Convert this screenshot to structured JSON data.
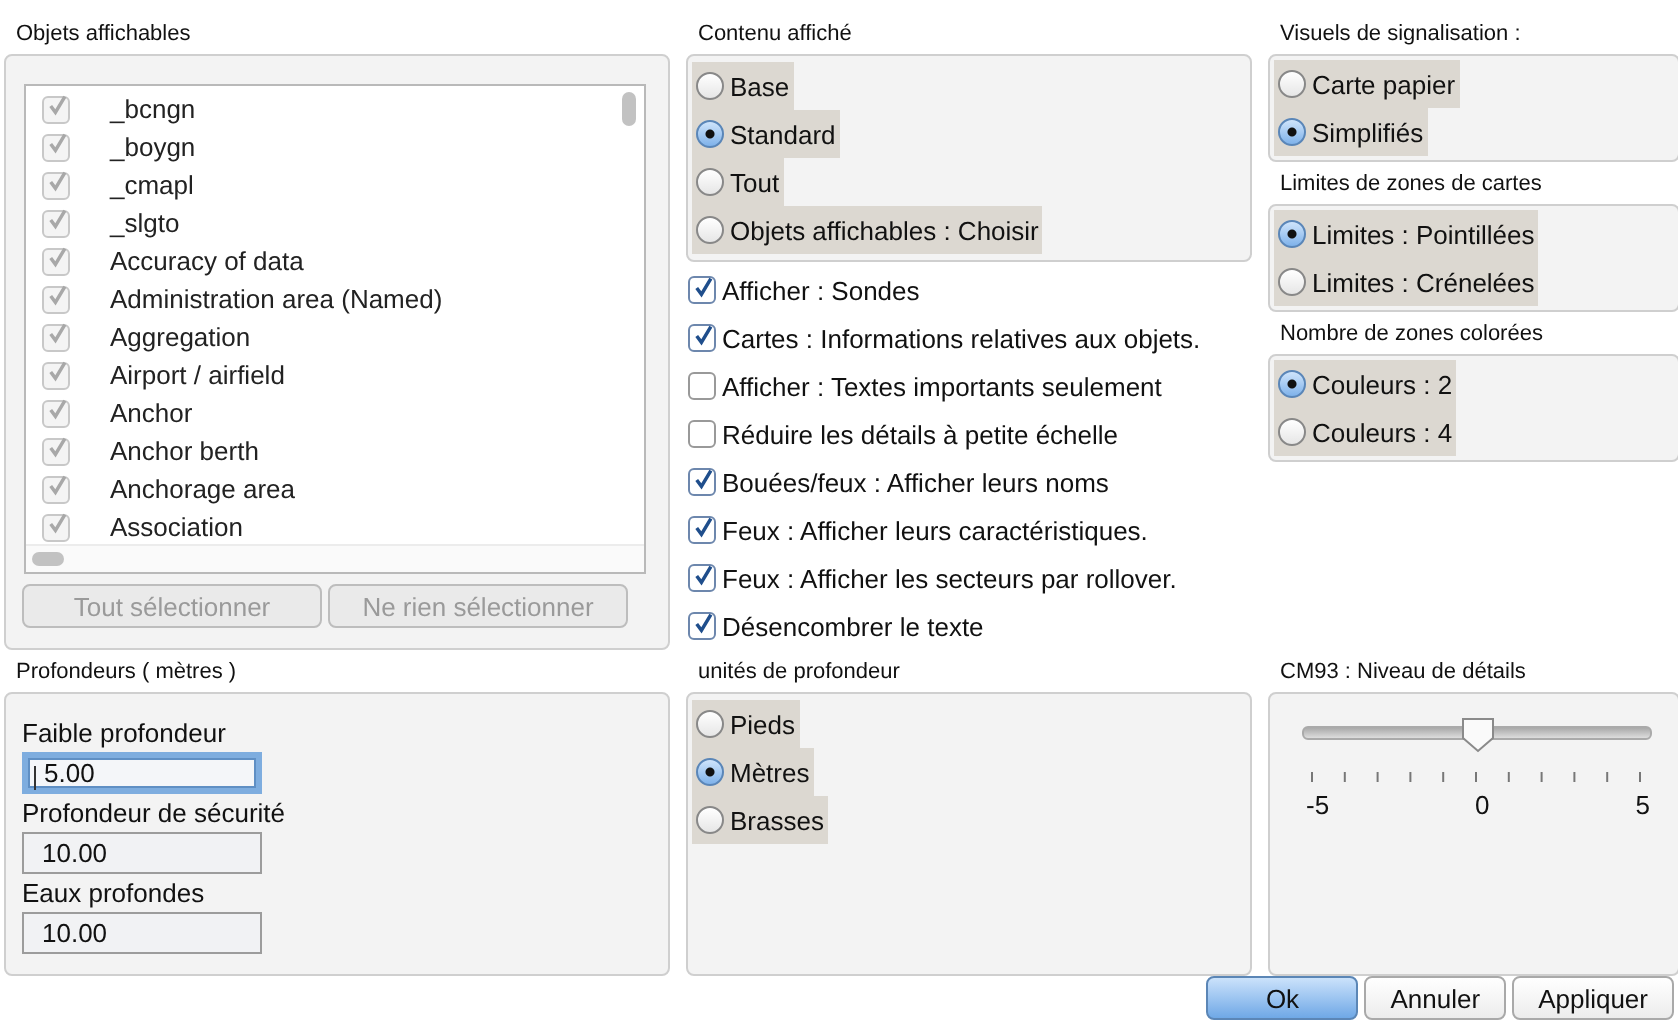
{
  "objets_affichables": {
    "title": "Objets affichables",
    "disabled": true,
    "items": [
      {
        "label": "_bcngn",
        "checked": true
      },
      {
        "label": "_boygn",
        "checked": true
      },
      {
        "label": "_cmapl",
        "checked": true
      },
      {
        "label": "_slgto",
        "checked": true
      },
      {
        "label": "Accuracy of data",
        "checked": true
      },
      {
        "label": "Administration area (Named)",
        "checked": true
      },
      {
        "label": "Aggregation",
        "checked": true
      },
      {
        "label": "Airport / airfield",
        "checked": true
      },
      {
        "label": "Anchor",
        "checked": true
      },
      {
        "label": "Anchor berth",
        "checked": true
      },
      {
        "label": "Anchorage area",
        "checked": true
      },
      {
        "label": "Association",
        "checked": true
      }
    ],
    "buttons": [
      {
        "label": "Tout sélectionner",
        "disabled": true
      },
      {
        "label": "Ne rien sélectionner",
        "disabled": true
      }
    ]
  },
  "contenu_affiche": {
    "title": "Contenu affiché",
    "options": [
      {
        "label": "Base",
        "selected": false
      },
      {
        "label": "Standard",
        "selected": true
      },
      {
        "label": "Tout",
        "selected": false
      },
      {
        "label": "Objets affichables : Choisir",
        "selected": false
      }
    ]
  },
  "options": [
    {
      "label": "Afficher : Sondes",
      "checked": true
    },
    {
      "label": "Cartes : Informations relatives aux objets.",
      "checked": true
    },
    {
      "label": "Afficher : Textes importants seulement",
      "checked": false
    },
    {
      "label": "Réduire les détails à petite échelle",
      "checked": false
    },
    {
      "label": "Bouées/feux : Afficher leurs noms",
      "checked": true
    },
    {
      "label": "Feux : Afficher leurs caractéristiques.",
      "checked": true
    },
    {
      "label": "Feux : Afficher les secteurs par rollover.",
      "checked": true
    },
    {
      "label": "Désencombrer le texte",
      "checked": true
    }
  ],
  "visuels_de_signalisation": {
    "title": "Visuels de signalisation :",
    "options": [
      {
        "label": "Carte papier",
        "selected": false
      },
      {
        "label": "Simplifiés",
        "selected": true
      }
    ]
  },
  "limites_de_zones": {
    "title": "Limites de zones de cartes",
    "options": [
      {
        "label": "Limites : Pointillées",
        "selected": true
      },
      {
        "label": "Limites : Crénelées",
        "selected": false
      }
    ]
  },
  "nombre_de_zones": {
    "title": "Nombre de zones colorées",
    "options": [
      {
        "label": "Couleurs : 2",
        "selected": true
      },
      {
        "label": "Couleurs : 4",
        "selected": false
      }
    ]
  },
  "profondeurs": {
    "title": "Profondeurs ( mètres )",
    "fields": [
      {
        "label": "Faible profondeur",
        "value": "5.00",
        "focused": true
      },
      {
        "label": "Profondeur de sécurité",
        "value": "10.00",
        "focused": false
      },
      {
        "label": "Eaux profondes",
        "value": "10.00",
        "focused": false
      }
    ]
  },
  "unites_de_profondeur": {
    "title": "unités de profondeur",
    "options": [
      {
        "label": "Pieds",
        "selected": false
      },
      {
        "label": "Mètres",
        "selected": true
      },
      {
        "label": "Brasses",
        "selected": false
      }
    ]
  },
  "cm93": {
    "title": "CM93 : Niveau de détails",
    "level": 0.5,
    "tick_labels": [
      "-5",
      "0",
      "5"
    ]
  },
  "buttons": [
    {
      "label": "Ok",
      "default": true
    },
    {
      "label": "Annuler",
      "default": false
    },
    {
      "label": "Appliquer",
      "default": false
    }
  ]
}
